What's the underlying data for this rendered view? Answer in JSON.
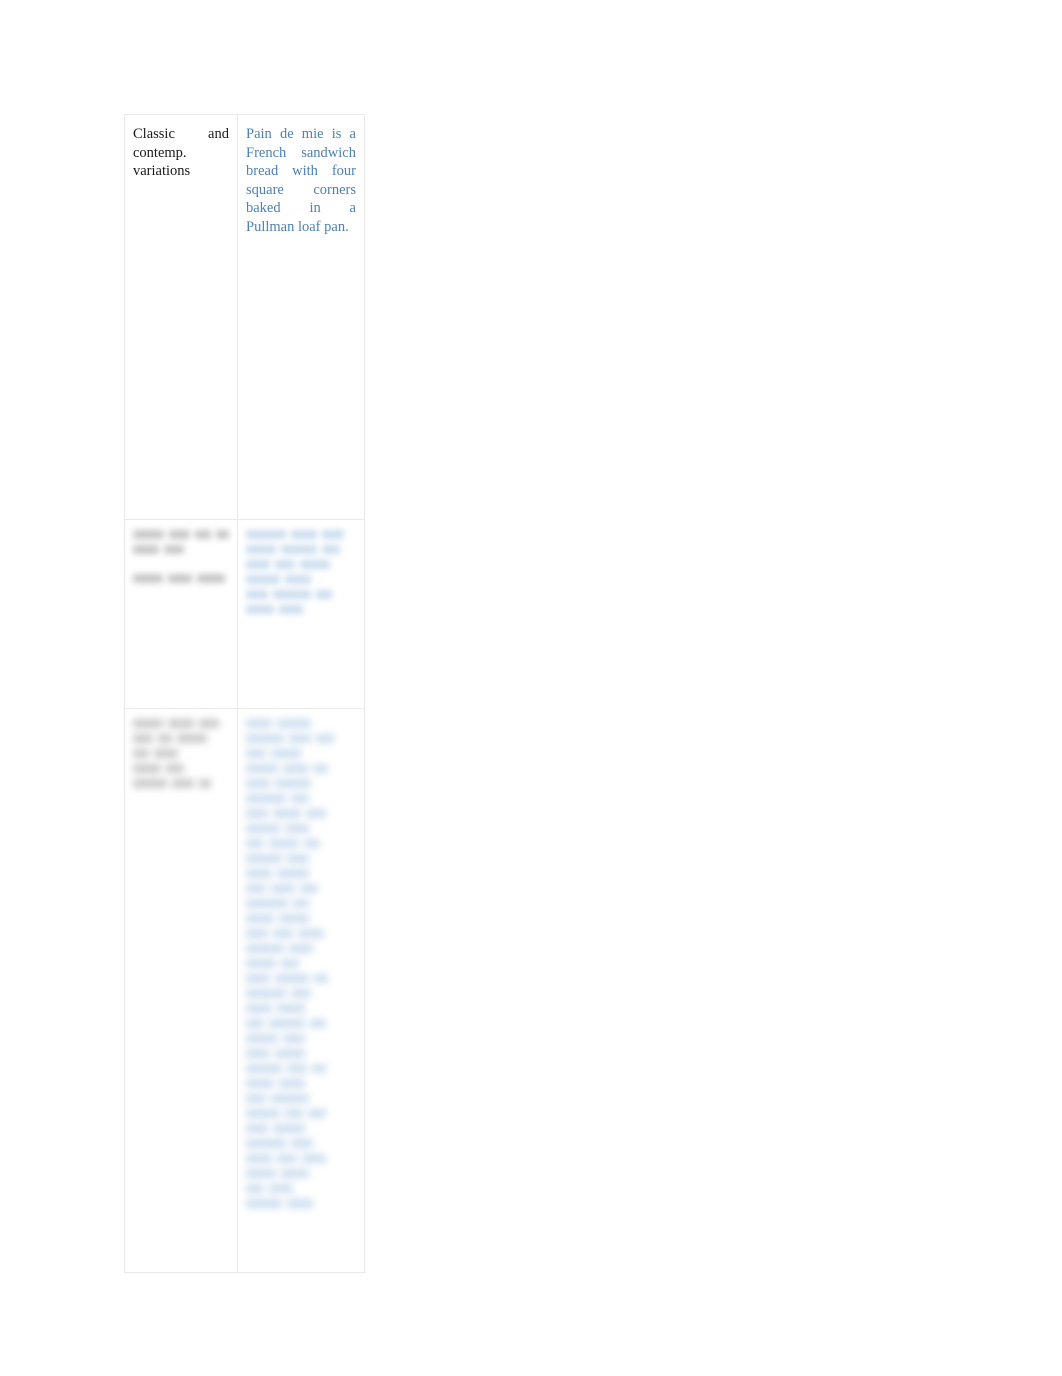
{
  "document": {
    "background_color": "#ffffff",
    "table": {
      "border_color": "#e9e9e9",
      "term_text_color": "#1a1a1a",
      "definition_text_color": "#4e80b4",
      "redacted_gray_color": "#bdbdbd",
      "redacted_blue_color": "#c3d7ec",
      "columns": 2,
      "rows": [
        {
          "row_index": 1,
          "legible": true,
          "term": "Classic and contemp. variations",
          "definition": "Pain de mie is a French sandwich bread with four square corners baked in a Pullman loaf pan."
        },
        {
          "row_index": 2,
          "legible": false,
          "term": "",
          "definition": "",
          "note": "text blurred / illegible in source image",
          "term_line_count": 2,
          "definition_line_count": 6
        },
        {
          "row_index": 3,
          "legible": false,
          "term": "",
          "definition": "",
          "note": "text blurred / illegible in source image",
          "term_line_count": 5,
          "definition_line_count": 33
        }
      ]
    }
  }
}
